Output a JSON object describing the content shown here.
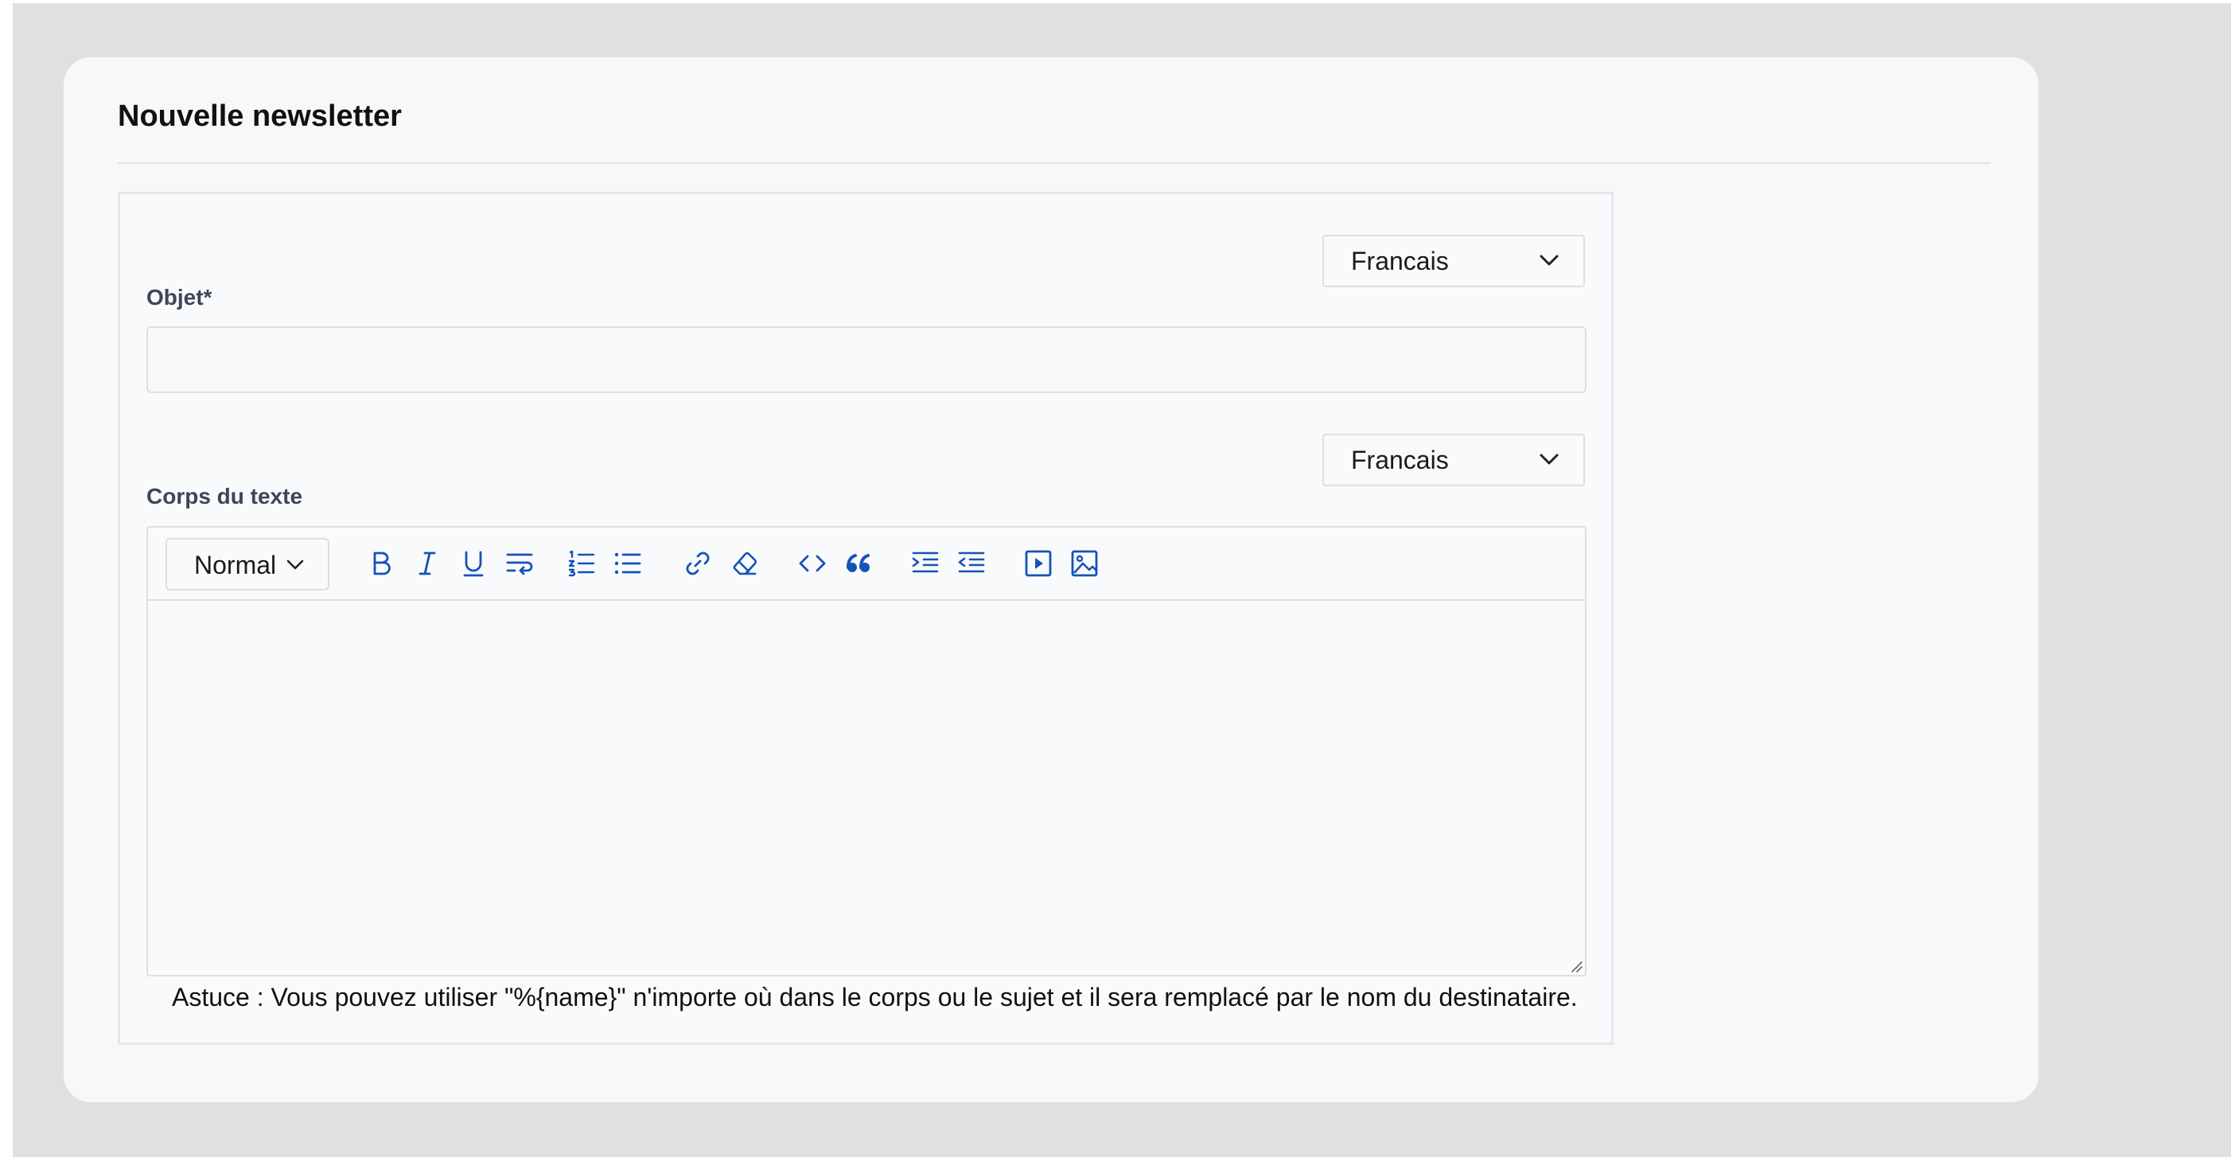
{
  "page": {
    "title": "Nouvelle newsletter"
  },
  "subject": {
    "language": "Francais",
    "label": "Objet*",
    "value": "",
    "placeholder": ""
  },
  "body": {
    "language": "Francais",
    "label": "Corps du texte",
    "value": "",
    "toolbar": {
      "heading_value": "Normal",
      "icons": [
        "bold-icon",
        "italic-icon",
        "underline-icon",
        "text-wrap-icon",
        "ordered-list-icon",
        "bullet-list-icon",
        "link-icon",
        "clear-format-icon",
        "code-icon",
        "blockquote-icon",
        "indent-icon",
        "outdent-icon",
        "video-icon",
        "image-icon"
      ]
    }
  },
  "hint": "Astuce : Vous pouvez utiliser \"%{name}\" n'importe où dans le corps ou le sujet et il sera remplacé par le nom du destinataire.",
  "colors": {
    "accent": "#1553b6",
    "label": "#3c4657",
    "border": "#dcdfe3",
    "background": "#e0e0e0"
  }
}
